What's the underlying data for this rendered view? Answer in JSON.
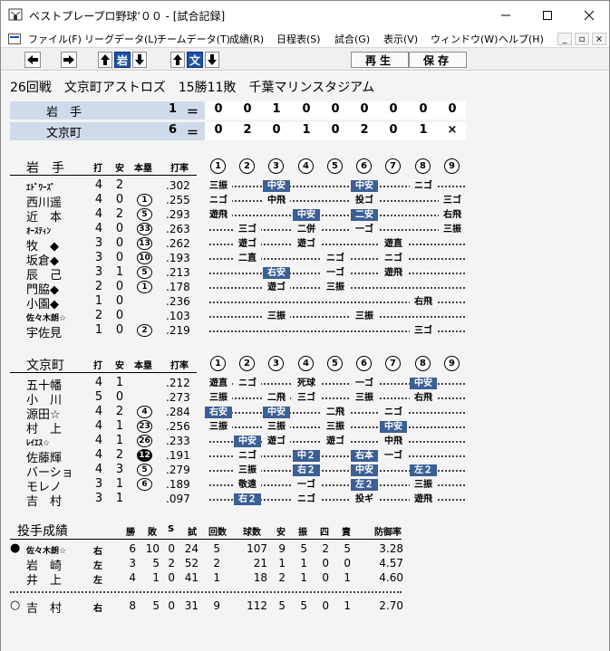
{
  "window": {
    "title": "ベストプレープロ野球'００ - [試合記録]",
    "min_icon": "minimize-icon",
    "max_icon": "maximize-icon",
    "close_icon": "close-icon"
  },
  "menu": [
    "ファイル(F)",
    "リーグデータ(L)",
    "チームデータ(T)",
    "成績(R)",
    "日程表(S)",
    "試合(G)",
    "表示(V)",
    "ウィンドウ(W)",
    "ヘルプ(H)"
  ],
  "toolbar": {
    "team_iwate": "岩",
    "team_bunkyo": "文",
    "play": "再生",
    "save": "保存"
  },
  "game": {
    "header": "26回戦　文京町アストロズ　15勝11敗　千葉マリンスタジアム"
  },
  "scoreboard": [
    {
      "team": "岩　手",
      "total": "1",
      "eq": "＝",
      "innings": [
        "0",
        "0",
        "1",
        "0",
        "0",
        "0",
        "0",
        "0",
        "0"
      ]
    },
    {
      "team": "文京町",
      "total": "6",
      "eq": "＝",
      "innings": [
        "0",
        "2",
        "0",
        "1",
        "0",
        "2",
        "0",
        "1",
        "×"
      ]
    }
  ],
  "col_headers": {
    "at_bat": "打",
    "hits": "安",
    "hr": "本塁",
    "avg": "打率",
    "innings": [
      "①",
      "②",
      "③",
      "④",
      "⑤",
      "⑥",
      "⑦",
      "⑧",
      "⑨"
    ]
  },
  "batting": [
    {
      "team": "岩　手",
      "players": [
        {
          "name": "ｴﾄﾞﾜｰｽﾞ",
          "kana": true,
          "ab": "4",
          "h": "2",
          "hr": "",
          "avg": ".302",
          "res": [
            [
              "三振",
              0
            ],
            [
              "中安",
              1
            ],
            [
              "",
              0
            ],
            [
              "中安",
              1
            ],
            [
              "ニゴ",
              0
            ]
          ]
        },
        {
          "name": "西川遥",
          "ab": "4",
          "h": "0",
          "hr": "1",
          "avg": ".255",
          "res": [
            [
              "ニゴ",
              0
            ],
            [
              "中飛",
              0
            ],
            [
              "",
              0
            ],
            [
              "投ゴ",
              0
            ],
            [
              "三ゴ",
              0
            ]
          ]
        },
        {
          "name": "近　本",
          "ab": "4",
          "h": "2",
          "hr": "5",
          "avg": ".293",
          "res": [
            [
              "遊飛",
              0
            ],
            [
              "中安",
              1
            ],
            [
              "二安",
              1
            ],
            [
              "右飛",
              0
            ]
          ]
        },
        {
          "name": "ｵｰｽﾃｨﾝ",
          "kana": true,
          "ab": "4",
          "h": "0",
          "hr": "33",
          "avg": ".263",
          "res": [
            [
              "三ゴ",
              0
            ],
            [
              "二併",
              0
            ],
            [
              "一ゴ",
              0
            ],
            [
              "三振",
              0
            ]
          ]
        },
        {
          "name": "牧　◆",
          "ab": "3",
          "h": "0",
          "hr": "13",
          "avg": ".262",
          "res": [
            [
              "遊ゴ",
              0
            ],
            [
              "遊ゴ",
              0
            ],
            [
              "遊直",
              0
            ]
          ]
        },
        {
          "name": "坂倉◆",
          "ab": "3",
          "h": "0",
          "hr": "10",
          "avg": ".193",
          "res": [
            [
              "二直",
              0
            ],
            [
              "ニゴ",
              0
            ],
            [
              "ニゴ",
              0
            ]
          ]
        },
        {
          "name": "辰　己",
          "ab": "3",
          "h": "1",
          "hr": "5",
          "avg": ".213",
          "res": [
            [
              "右安",
              1
            ],
            [
              "一ゴ",
              0
            ],
            [
              "遊飛",
              0
            ]
          ]
        },
        {
          "name": "門脇◆",
          "ab": "2",
          "h": "0",
          "hr": "1",
          "avg": ".178",
          "res": [
            [
              "遊ゴ",
              0
            ],
            [
              "三振",
              0
            ]
          ]
        },
        {
          "name": "小園◆",
          "ab": "1",
          "h": "0",
          "hr": "",
          "avg": ".236",
          "res": [
            [
              "右飛",
              0
            ]
          ]
        },
        {
          "name": "佐々木朗☆",
          "kana": true,
          "ab": "2",
          "h": "0",
          "hr": "",
          "avg": ".103",
          "res": [
            [
              "三振",
              0
            ],
            [
              "三振",
              0
            ]
          ]
        },
        {
          "name": "宇佐見",
          "ab": "1",
          "h": "0",
          "hr": "2",
          "avg": ".219",
          "res": [
            [
              "三ゴ",
              0
            ]
          ]
        }
      ]
    },
    {
      "team": "文京町",
      "players": [
        {
          "name": "五十幡",
          "ab": "4",
          "h": "1",
          "hr": "",
          "avg": ".212",
          "res": [
            [
              "遊直",
              0
            ],
            [
              "ニゴ",
              0
            ],
            [
              "死球",
              0
            ],
            [
              "一ゴ",
              0
            ],
            [
              "中安",
              1
            ]
          ]
        },
        {
          "name": "小　川",
          "ab": "5",
          "h": "0",
          "hr": "",
          "avg": ".273",
          "res": [
            [
              "三振",
              0
            ],
            [
              "二飛",
              0
            ],
            [
              "三ゴ",
              0
            ],
            [
              "三振",
              0
            ],
            [
              "右飛",
              0
            ]
          ]
        },
        {
          "name": "源田☆",
          "ab": "4",
          "h": "2",
          "hr": "4",
          "avg": ".284",
          "res": [
            [
              "右安",
              1
            ],
            [
              "中安",
              1
            ],
            [
              "二飛",
              0
            ],
            [
              "ニゴ",
              0
            ]
          ]
        },
        {
          "name": "村　上",
          "ab": "4",
          "h": "1",
          "hr": "23",
          "avg": ".256",
          "res": [
            [
              "三振",
              0
            ],
            [
              "三振",
              0
            ],
            [
              "三振",
              0
            ],
            [
              "中安",
              1
            ]
          ]
        },
        {
          "name": "ﾚｲｴｽ☆",
          "kana": true,
          "ab": "4",
          "h": "1",
          "hr": "26",
          "avg": ".233",
          "res": [
            [
              "中安",
              1
            ],
            [
              "遊ゴ",
              0
            ],
            [
              "遊ゴ",
              0
            ],
            [
              "中飛",
              0
            ]
          ]
        },
        {
          "name": "佐藤輝",
          "ab": "4",
          "h": "2",
          "hr": "12",
          "hrfill": true,
          "avg": ".191",
          "res": [
            [
              "ニゴ",
              0
            ],
            [
              "中２",
              1
            ],
            [
              "右本",
              1
            ],
            [
              "一ゴ",
              0
            ]
          ]
        },
        {
          "name": "バーショ",
          "ab": "4",
          "h": "3",
          "hr": "5",
          "avg": ".279",
          "res": [
            [
              "三振",
              0
            ],
            [
              "右２",
              1
            ],
            [
              "中安",
              1
            ],
            [
              "左２",
              1
            ]
          ]
        },
        {
          "name": "モレノ",
          "ab": "3",
          "h": "1",
          "hr": "6",
          "avg": ".189",
          "res": [
            [
              "敬遠",
              0
            ],
            [
              "一ゴ",
              0
            ],
            [
              "左２",
              1
            ],
            [
              "三振",
              0
            ]
          ]
        },
        {
          "name": "吉　村",
          "ab": "3",
          "h": "1",
          "hr": "",
          "avg": ".097",
          "res": [
            [
              "右２",
              1
            ],
            [
              "ニゴ",
              0
            ],
            [
              "投ギ",
              0
            ],
            [
              "遊飛",
              0
            ]
          ]
        }
      ]
    }
  ],
  "pitching": {
    "title": "投手成績",
    "headers": [
      "勝",
      "敗",
      "S",
      "試",
      "回数",
      "球数",
      "安",
      "振",
      "四",
      "責",
      "防御率"
    ],
    "iwate": [
      {
        "mark": "●",
        "name": "佐々木朗☆",
        "kana": true,
        "hand": "右",
        "w": "6",
        "l": "10",
        "s": "0",
        "g": "24",
        "ip": "5",
        "np": "107",
        "h": "9",
        "k": "5",
        "bb": "2",
        "er": "5",
        "era": "3.28"
      },
      {
        "mark": "",
        "name": "岩　崎",
        "hand": "左",
        "w": "3",
        "l": "5",
        "s": "2",
        "g": "52",
        "ip": "2",
        "np": "21",
        "h": "1",
        "k": "1",
        "bb": "0",
        "er": "0",
        "era": "4.57"
      },
      {
        "mark": "",
        "name": "井　上",
        "hand": "左",
        "w": "4",
        "l": "1",
        "s": "0",
        "g": "41",
        "ip": "1",
        "np": "18",
        "h": "2",
        "k": "1",
        "bb": "0",
        "er": "1",
        "era": "4.60"
      }
    ],
    "bunkyo": [
      {
        "mark": "○",
        "name": "吉　村",
        "hand": "右",
        "w": "8",
        "l": "5",
        "s": "0",
        "g": "31",
        "ip": "9",
        "np": "112",
        "h": "5",
        "k": "5",
        "bb": "0",
        "er": "1",
        "era": "2.70"
      }
    ]
  }
}
